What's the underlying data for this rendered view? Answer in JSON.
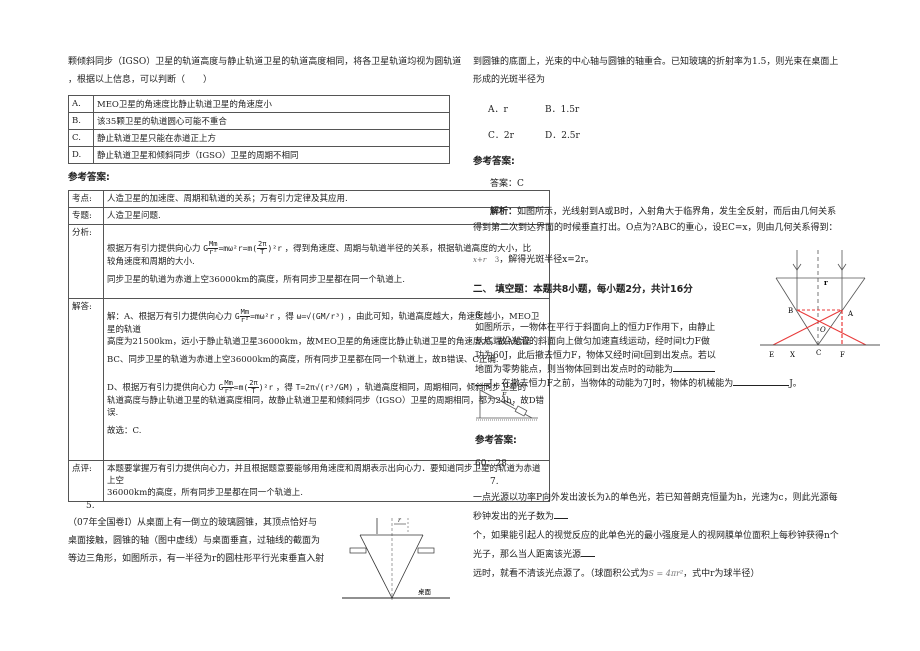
{
  "left": {
    "intro_line1": "颗倾斜同步（IGSO）卫星的轨道高度与静止轨道卫星的轨道高度相同，将各卫星轨道均视为圆轨道",
    "intro_line2": "，根据以上信息，可以判断（　　）",
    "options": [
      {
        "key": "A.",
        "text": "MEO卫星的角速度比静止轨道卫星的角速度小"
      },
      {
        "key": "B.",
        "text": "该35颗卫星的轨道圆心可能不重合"
      },
      {
        "key": "C.",
        "text": "静止轨道卫星只能在赤道正上方"
      },
      {
        "key": "D.",
        "text": "静止轨道卫星和倾斜同步（IGSO）卫星的周期不相同"
      }
    ],
    "answer_heading": "参考答案:",
    "rows": {
      "kaodian": {
        "label": "考点:",
        "text": "人造卫星的加速度、周期和轨道的关系；万有引力定律及其应用."
      },
      "zhuanti": {
        "label": "专题:",
        "text": "人造卫星问题."
      },
      "fenxi": {
        "label": "分析:",
        "formula": "G Mm/r² = mω²r = m(2π/T)² r",
        "line1_pre": "根据万有引力提供向心力",
        "line1_post": "，得到角速度、周期与轨道半径的关系，根据轨道高度的大小，比",
        "line2": "较角速度和周期的大小.",
        "line3": "同步卫星的轨道为赤道上空36000km的高度，所有同步卫星都在同一个轨道上."
      },
      "jieda": {
        "label": "解答:",
        "a_pre": "解：A、根据万有引力提供向心力",
        "a_mid": "，得",
        "a_post": "，由此可知，轨道高度越大，角速度越小，MEO卫星的轨道",
        "a_line2": "高度为21500km，远小于静止轨道卫星36000km，故MEO卫星的角速度比静止轨道卫星的角速度大，故A错误.",
        "bc": "BC、同步卫星的轨道为赤道上空36000km的高度，所有同步卫星都在同一个轨道上，故B错误、C正确.",
        "d_pre": "D、根据万有引力提供向心力",
        "d_mid": "，得",
        "d_post": "，轨道高度相同，周期相同，倾斜同步卫星的",
        "d_line2": "轨道高度与静止轨道卫星的轨道高度相同，故静止轨道卫星和倾斜同步（IGSO）卫星的周期相同，都为24h，故D错误.",
        "conclusion": "故选：C."
      },
      "dianping": {
        "label": "点评:",
        "line1": "本题要掌握万有引力提供向心力，并且根据题意要能够用角速度和周期表示出向心力．要知道同步卫星的轨道为赤道上空",
        "line2": "36000km的高度，所有同步卫星都在同一个轨道上."
      }
    },
    "q5": {
      "number": "5.",
      "line1": "（07年全国卷Ⅰ）从桌面上有一倒立的玻璃圆锥，其顶点恰好与",
      "line2": "桌面接触，圆锥的轴（图中虚线）与桌面垂直，过轴线的截面为",
      "line3": "等边三角形，如图所示，有一半径为r的圆柱形平行光束垂直入射",
      "figure_labels": {
        "radius": "r",
        "table": "桌面"
      }
    }
  },
  "right": {
    "q5_cont_line1": "到圆锥的底面上，光束的中心轴与圆锥的轴重合。已知玻璃的折射率为1.5，则光束在桌面上",
    "q5_cont_line2": "形成的光斑半径为",
    "choices": [
      {
        "label": "A．r"
      },
      {
        "label": "B．1.5r"
      },
      {
        "label": "C．2r"
      },
      {
        "label": "D．2.5r"
      }
    ],
    "answer_heading": "参考答案:",
    "answer": "答案：C",
    "analysis_label": "解析：",
    "analysis_line1": "如图所示，光线射到A或B时，入射角大于临界角，发生全反射，而后由几何关系",
    "analysis_line2": "得到第二次到达界面的时候垂直打出。O点为?ABC的重心，设EC=x，则由几何关系得到：",
    "analysis_line3": "，解得光斑半径x=2r。",
    "analysis_formula": "x+r",
    "analysis_formula_sup": "3",
    "figure_labels": {
      "B": "B",
      "A": "A",
      "O": "O",
      "E": "E",
      "X": "X",
      "C": "C",
      "F": "F",
      "r": "r"
    },
    "section_heading": "二、 填空题：本题共8小题，每小题2分，共计16分",
    "q6": {
      "number": "6.",
      "line1": "如图所示，一物体在平行于斜面向上的恒力F作用下，由静止",
      "line2": "从底端沿光滑的斜面向上做匀加速直线运动，经时间t力F做",
      "line3": "功为60J，此后撤去恒力F，物体又经时间t回到出发点。若以",
      "line4": "地面为零势能点，则当物体回到出发点时的动能为",
      "line5_pre": "J，在撤去恒力F之前，当物体的动能为7J时，物体的机械能为",
      "line5_post": "J。",
      "figure_label": "F",
      "answer_heading": "参考答案:",
      "answer": "60；28"
    },
    "q7": {
      "number": "7.",
      "line1": "一点光源以功率P向外发出波长为λ的单色光，若已知普朗克恒量为h，光速为c，则此光源每",
      "line2": "秒钟发出的光子数为",
      "line3": "个，如果能引起人的视觉反应的此单色光的最小强度是人的视网膜单位面积上每秒钟获得n个",
      "line4": "光子，那么当人距离该光源",
      "line5_pre": "远时，就看不清该光点源了。（球面积公式为",
      "line5_formula": "S = 4πr²",
      "line5_post": "，式中r为球半径）"
    }
  },
  "colors": {
    "text": "#222222",
    "red_ray": "#e83a3a",
    "border": "#555555"
  }
}
